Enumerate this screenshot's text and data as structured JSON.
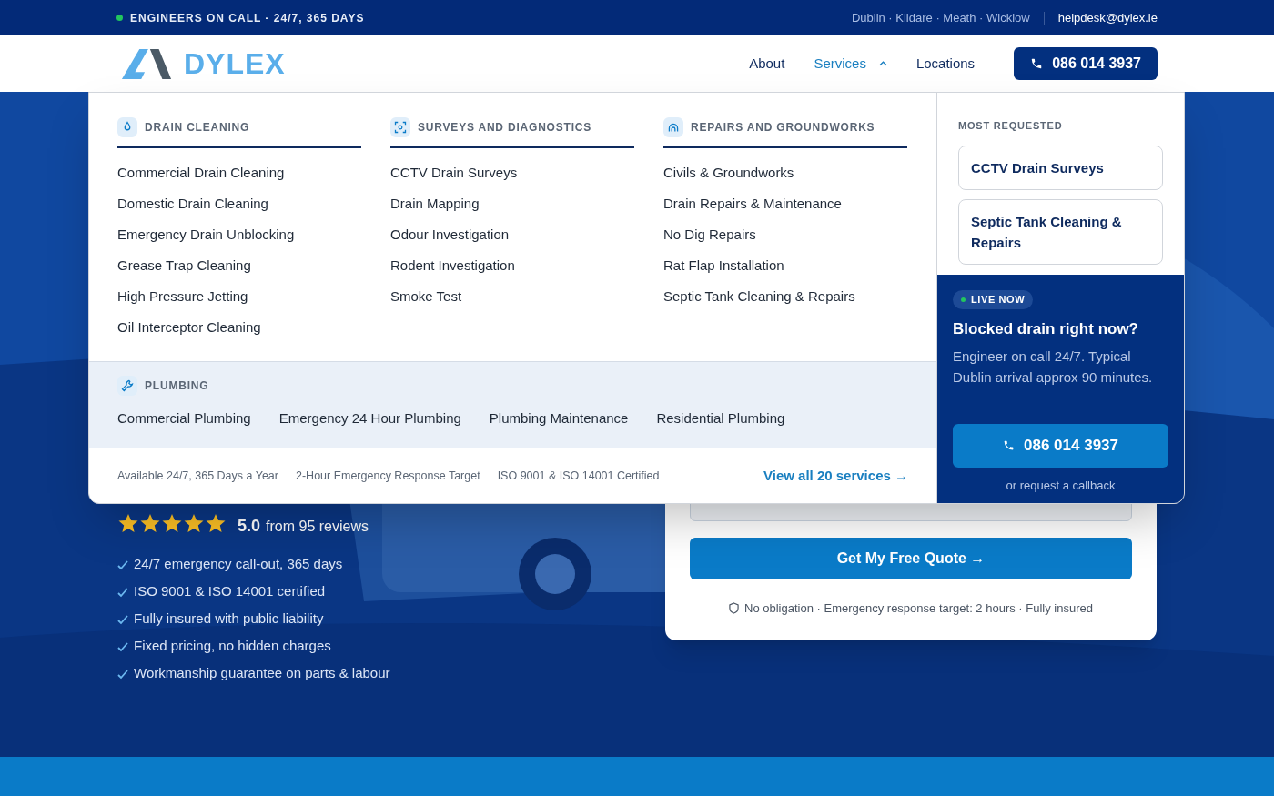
{
  "top_bar": {
    "status": "ENGINEERS ON CALL - 24/7, 365 DAYS",
    "areas": "Dublin · Kildare · Meath · Wicklow",
    "email": "helpdesk@dylex.ie"
  },
  "header": {
    "logo": "DYLEX",
    "nav": [
      {
        "label": "About",
        "selected": false,
        "expanded": false
      },
      {
        "label": "Services",
        "selected": true,
        "expanded": true
      },
      {
        "label": "Locations",
        "selected": false,
        "expanded": false
      }
    ],
    "phone": "086 014 3937"
  },
  "menu": {
    "columns": [
      {
        "kind": "drop",
        "title": "DRAIN CLEANING",
        "items": [
          "Commercial Drain Cleaning",
          "Domestic Drain Cleaning",
          "Emergency Drain Unblocking",
          "Grease Trap Cleaning",
          "High Pressure Jetting",
          "Oil Interceptor Cleaning"
        ]
      },
      {
        "kind": "scan",
        "title": "SURVEYS AND DIAGNOSTICS",
        "items": [
          "CCTV Drain Surveys",
          "Drain Mapping",
          "Odour Investigation",
          "Rodent Investigation",
          "Smoke Test"
        ]
      },
      {
        "kind": "arch",
        "title": "REPAIRS AND GROUNDWORKS",
        "items": [
          "Civils & Groundworks",
          "Drain Repairs & Maintenance",
          "No Dig Repairs",
          "Rat Flap Installation",
          "Septic Tank Cleaning & Repairs"
        ]
      }
    ],
    "plumbing": {
      "title": "PLUMBING",
      "items": [
        "Commercial Plumbing",
        "Emergency 24 Hour Plumbing",
        "Plumbing Maintenance",
        "Residential Plumbing"
      ]
    },
    "facts": [
      "Available 24/7, 365 Days a Year",
      "2-Hour Emergency Response Target",
      "ISO 9001 & ISO 14001 Certified"
    ],
    "view_all": "View all 20 services →",
    "most_requested": {
      "title": "MOST REQUESTED",
      "items": [
        "CCTV Drain Surveys",
        "Septic Tank Cleaning & Repairs"
      ]
    },
    "live": {
      "badge": "LIVE NOW",
      "title": "Blocked drain right now?",
      "text": "Engineer on call 24/7. Typical Dublin arrival approx 90 minutes.",
      "phone": "086 014 3937",
      "callback": "or request a callback"
    }
  },
  "hero": {
    "stars": 5,
    "rating": "5.0",
    "reviews": "from 95 reviews",
    "checks": [
      "24/7 emergency call-out, 365 days",
      "ISO 9001 & ISO 14001 certified",
      "Fully insured with public liability",
      "Fixed pricing, no hidden charges",
      "Workmanship guarantee on parts & labour"
    ]
  },
  "quote_form": {
    "submit": "Get My Free Quote →",
    "note": "No obligation · Emergency response target: 2 hours · Fully insured"
  }
}
